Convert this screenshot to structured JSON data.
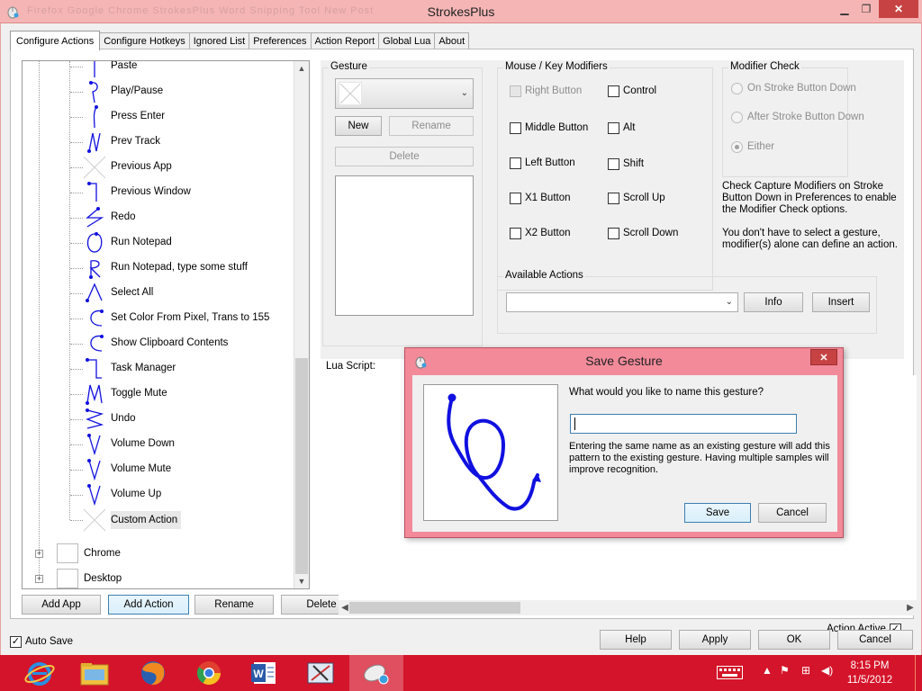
{
  "window": {
    "title": "StrokesPlus",
    "background_tabs": "Firefox   Google Chrome   StrokesPlus   Word   Snipping Tool   New Post"
  },
  "tabs": [
    "Configure Actions",
    "Configure Hotkeys",
    "Ignored List",
    "Preferences",
    "Action Report",
    "Global Lua",
    "About"
  ],
  "tree": {
    "actions": [
      "Paste",
      "Play/Pause",
      "Press Enter",
      "Prev Track",
      "Previous App",
      "Previous Window",
      "Redo",
      "Run Notepad",
      "Run Notepad, type some stuff",
      "Select All",
      "Set Color From Pixel, Trans to 155",
      "Show Clipboard Contents",
      "Task Manager",
      "Toggle Mute",
      "Undo",
      "Volume Down",
      "Volume Mute",
      "Volume Up",
      "Custom Action"
    ],
    "apps": [
      "Chrome",
      "Desktop"
    ],
    "expander_symbol": "+"
  },
  "left_buttons": {
    "add_app": "Add App",
    "add_action": "Add Action",
    "rename": "Rename",
    "delete": "Delete"
  },
  "gesture": {
    "title": "Gesture",
    "new": "New",
    "rename": "Rename",
    "delete": "Delete"
  },
  "modifiers": {
    "title": "Mouse / Key Modifiers",
    "left_col": [
      "Right Button",
      "Middle Button",
      "Left Button",
      "X1 Button",
      "X2 Button"
    ],
    "right_col": [
      "Control",
      "Alt",
      "Shift",
      "Scroll Up",
      "Scroll Down"
    ]
  },
  "modifier_check": {
    "title": "Modifier Check",
    "options": [
      "On Stroke Button Down",
      "After Stroke Button Down",
      "Either"
    ],
    "selected": "Either",
    "note1": "Check Capture Modifiers on Stroke Button Down in Preferences to enable the Modifier Check options.",
    "note2": "You don't have to select a gesture, modifier(s) alone can define an action."
  },
  "available_actions": {
    "title": "Available Actions",
    "info": "Info",
    "insert": "Insert"
  },
  "lua": {
    "label": "Lua Script:"
  },
  "dialog": {
    "title": "Save Gesture",
    "question": "What would you like to name this gesture?",
    "input_value": "",
    "hint": "Entering the same name as an existing gesture will add this pattern to the existing gesture. Having multiple samples will improve recognition.",
    "save": "Save",
    "cancel": "Cancel",
    "close_symbol": "✕"
  },
  "bottom": {
    "action_active": "Action Active",
    "auto_save": "Auto Save",
    "help": "Help",
    "apply": "Apply",
    "ok": "OK",
    "cancel": "Cancel"
  },
  "window_controls": {
    "minimize": "▁",
    "maximize": "❐",
    "close": "✕"
  },
  "taskbar": {
    "time": "8:15 PM",
    "date": "11/5/2012",
    "apps": [
      "internet-explorer",
      "file-explorer",
      "firefox",
      "chrome",
      "word",
      "snipping-tool",
      "strokesplus"
    ]
  },
  "colors": {
    "accent": "#d4142a",
    "stroke": "#1010e0",
    "dialog_border": "#f28a9a"
  }
}
